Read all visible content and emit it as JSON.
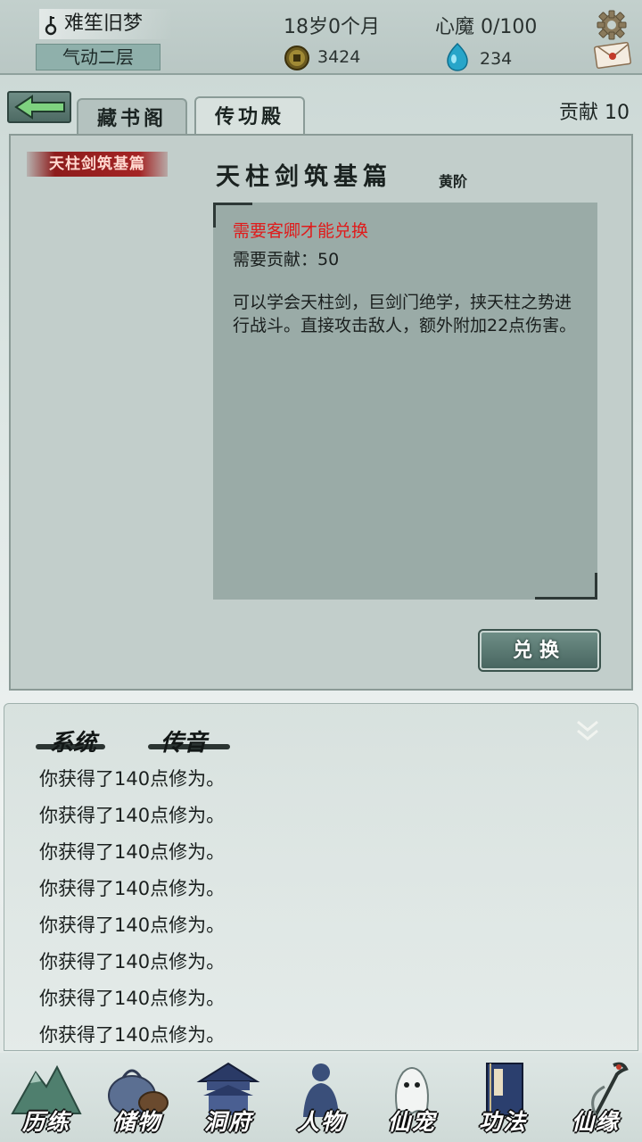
{
  "header": {
    "player_name": "难笙旧梦",
    "realm": "气动二层",
    "age": "18岁0个月",
    "xinmo": "心魔  0/100",
    "coins": "3424",
    "gems": "234"
  },
  "tabs": [
    {
      "label": "藏书阁"
    },
    {
      "label": "传功殿"
    }
  ],
  "contribution": "贡献  10",
  "skill_list": [
    {
      "label": "天柱剑筑基篇"
    }
  ],
  "skill_detail": {
    "title": "天柱剑筑基篇",
    "grade": "黄阶",
    "requirement_warning": "需要客卿才能兑换",
    "requirement_contribution": "需要贡献：50",
    "description": "可以学会天柱剑，巨剑门绝学，挟天柱之势进行战斗。直接攻击敌人，额外附加22点伤害。"
  },
  "exchange_button": "兑换",
  "chat": {
    "tabs": [
      {
        "label": "系统"
      },
      {
        "label": "传音"
      }
    ],
    "messages": [
      "你获得了140点修为。",
      "你获得了140点修为。",
      "你获得了140点修为。",
      "你获得了140点修为。",
      "你获得了140点修为。",
      "你获得了140点修为。",
      "你获得了140点修为。",
      "你获得了140点修为。"
    ]
  },
  "nav": [
    {
      "label": "历练",
      "icon": "mountain-icon"
    },
    {
      "label": "储物",
      "icon": "bag-icon"
    },
    {
      "label": "洞府",
      "icon": "pavilion-icon"
    },
    {
      "label": "人物",
      "icon": "person-icon"
    },
    {
      "label": "仙宠",
      "icon": "spirit-pet-icon"
    },
    {
      "label": "功法",
      "icon": "book-icon"
    },
    {
      "label": "仙缘",
      "icon": "crane-icon"
    }
  ],
  "colors": {
    "warning": "#e01b1b",
    "accent": "#5d7c75"
  }
}
